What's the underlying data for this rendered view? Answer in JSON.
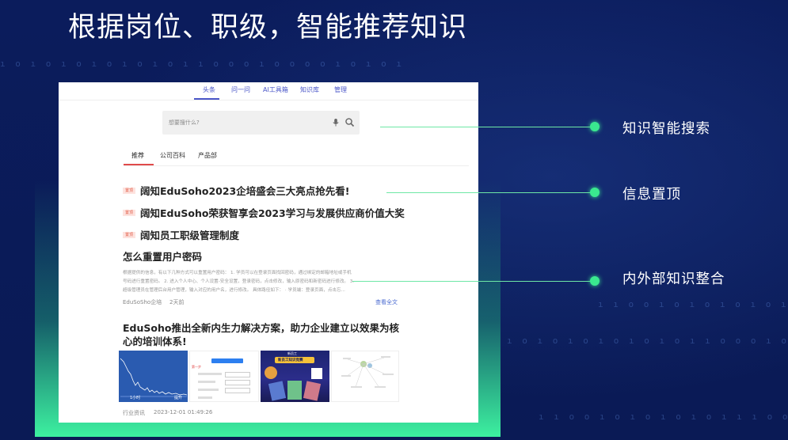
{
  "slide_title": "根据岗位、职级，智能推荐知识",
  "binary_rows": [
    "ı o ı o ı o ı o ı o ı o ı ı o o o ı o o o o ı o ı o ı",
    "ı ı o o ı o ı o ı o ı o ı ı ı o o o ı ı ı o ı",
    "ı o ı o ı o ı o ı o ı o ı ı o o o ı o o o o ı o ı",
    "ı ı o o ı o ı o ı o ı o ı ı ı o o o ı ı ı o ı"
  ],
  "app": {
    "top_nav": [
      "头条",
      "问一问",
      "AI工具箱",
      "知识库",
      "管理"
    ],
    "search_placeholder": "想要搜什么?",
    "sub_tabs": [
      "推荐",
      "公司百科",
      "产品部"
    ],
    "pin_badge": "置顶",
    "pinned": [
      "阔知EduSoho2023企培盛会三大亮点抢先看!",
      "阔知EduSoho荣获智享会2023学习与发展供应商价值大奖",
      "阔知员工职级管理制度"
    ],
    "article1": {
      "title": "怎么重置用户密码",
      "body_lines": [
        "根据提供的信息，有以下几种方式可以重置用户密码：  1. 学员可以在登录页面找回密码，通过绑定的邮箱地址或手机",
        "号码进行重置密码。 2. 进入个人中心、个人设置-安全设置，登录密码，点击修改，输入原密码和新密码进行修改。 3.",
        "超级管理员在管理后台用户管理，输入对应的用户名，进行修改。 具体路径如下：  · 学员端：登录页面，点击忘..."
      ],
      "source": "EduSoSho企培",
      "time": "2天前",
      "read_more": "查看全文"
    },
    "article2": {
      "title_line1": "EduSoho推出全新内生力解决方案，助力企业建立以效果为核",
      "title_line2": "心的培训体系!",
      "thumb1_label_left": "1小时",
      "thumb1_label_right": "提升",
      "thumb2_label": "第一步",
      "thumb3_title": "新员工知识竞赛",
      "thumb3_top": "新员工",
      "category": "行业资讯",
      "time": "2023-12-01 01:49:26"
    }
  },
  "callouts": [
    {
      "label": "知识智能搜索"
    },
    {
      "label": "信息置顶"
    },
    {
      "label": "内外部知识整合"
    }
  ],
  "colors": {
    "background": "#0a1a55",
    "accent_green": "#3ae88f",
    "nav_blue": "#4a56c8",
    "pin_red": "#e25a45"
  }
}
